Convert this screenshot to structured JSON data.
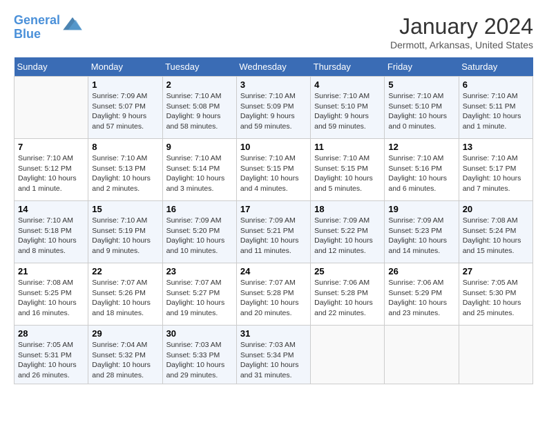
{
  "header": {
    "logo_line1": "General",
    "logo_line2": "Blue",
    "month": "January 2024",
    "location": "Dermott, Arkansas, United States"
  },
  "days_of_week": [
    "Sunday",
    "Monday",
    "Tuesday",
    "Wednesday",
    "Thursday",
    "Friday",
    "Saturday"
  ],
  "weeks": [
    [
      {
        "day": "",
        "sunrise": "",
        "sunset": "",
        "daylight": ""
      },
      {
        "day": "1",
        "sunrise": "Sunrise: 7:09 AM",
        "sunset": "Sunset: 5:07 PM",
        "daylight": "Daylight: 9 hours and 57 minutes."
      },
      {
        "day": "2",
        "sunrise": "Sunrise: 7:10 AM",
        "sunset": "Sunset: 5:08 PM",
        "daylight": "Daylight: 9 hours and 58 minutes."
      },
      {
        "day": "3",
        "sunrise": "Sunrise: 7:10 AM",
        "sunset": "Sunset: 5:09 PM",
        "daylight": "Daylight: 9 hours and 59 minutes."
      },
      {
        "day": "4",
        "sunrise": "Sunrise: 7:10 AM",
        "sunset": "Sunset: 5:10 PM",
        "daylight": "Daylight: 9 hours and 59 minutes."
      },
      {
        "day": "5",
        "sunrise": "Sunrise: 7:10 AM",
        "sunset": "Sunset: 5:10 PM",
        "daylight": "Daylight: 10 hours and 0 minutes."
      },
      {
        "day": "6",
        "sunrise": "Sunrise: 7:10 AM",
        "sunset": "Sunset: 5:11 PM",
        "daylight": "Daylight: 10 hours and 1 minute."
      }
    ],
    [
      {
        "day": "7",
        "sunrise": "Sunrise: 7:10 AM",
        "sunset": "Sunset: 5:12 PM",
        "daylight": "Daylight: 10 hours and 1 minute."
      },
      {
        "day": "8",
        "sunrise": "Sunrise: 7:10 AM",
        "sunset": "Sunset: 5:13 PM",
        "daylight": "Daylight: 10 hours and 2 minutes."
      },
      {
        "day": "9",
        "sunrise": "Sunrise: 7:10 AM",
        "sunset": "Sunset: 5:14 PM",
        "daylight": "Daylight: 10 hours and 3 minutes."
      },
      {
        "day": "10",
        "sunrise": "Sunrise: 7:10 AM",
        "sunset": "Sunset: 5:15 PM",
        "daylight": "Daylight: 10 hours and 4 minutes."
      },
      {
        "day": "11",
        "sunrise": "Sunrise: 7:10 AM",
        "sunset": "Sunset: 5:15 PM",
        "daylight": "Daylight: 10 hours and 5 minutes."
      },
      {
        "day": "12",
        "sunrise": "Sunrise: 7:10 AM",
        "sunset": "Sunset: 5:16 PM",
        "daylight": "Daylight: 10 hours and 6 minutes."
      },
      {
        "day": "13",
        "sunrise": "Sunrise: 7:10 AM",
        "sunset": "Sunset: 5:17 PM",
        "daylight": "Daylight: 10 hours and 7 minutes."
      }
    ],
    [
      {
        "day": "14",
        "sunrise": "Sunrise: 7:10 AM",
        "sunset": "Sunset: 5:18 PM",
        "daylight": "Daylight: 10 hours and 8 minutes."
      },
      {
        "day": "15",
        "sunrise": "Sunrise: 7:10 AM",
        "sunset": "Sunset: 5:19 PM",
        "daylight": "Daylight: 10 hours and 9 minutes."
      },
      {
        "day": "16",
        "sunrise": "Sunrise: 7:09 AM",
        "sunset": "Sunset: 5:20 PM",
        "daylight": "Daylight: 10 hours and 10 minutes."
      },
      {
        "day": "17",
        "sunrise": "Sunrise: 7:09 AM",
        "sunset": "Sunset: 5:21 PM",
        "daylight": "Daylight: 10 hours and 11 minutes."
      },
      {
        "day": "18",
        "sunrise": "Sunrise: 7:09 AM",
        "sunset": "Sunset: 5:22 PM",
        "daylight": "Daylight: 10 hours and 12 minutes."
      },
      {
        "day": "19",
        "sunrise": "Sunrise: 7:09 AM",
        "sunset": "Sunset: 5:23 PM",
        "daylight": "Daylight: 10 hours and 14 minutes."
      },
      {
        "day": "20",
        "sunrise": "Sunrise: 7:08 AM",
        "sunset": "Sunset: 5:24 PM",
        "daylight": "Daylight: 10 hours and 15 minutes."
      }
    ],
    [
      {
        "day": "21",
        "sunrise": "Sunrise: 7:08 AM",
        "sunset": "Sunset: 5:25 PM",
        "daylight": "Daylight: 10 hours and 16 minutes."
      },
      {
        "day": "22",
        "sunrise": "Sunrise: 7:07 AM",
        "sunset": "Sunset: 5:26 PM",
        "daylight": "Daylight: 10 hours and 18 minutes."
      },
      {
        "day": "23",
        "sunrise": "Sunrise: 7:07 AM",
        "sunset": "Sunset: 5:27 PM",
        "daylight": "Daylight: 10 hours and 19 minutes."
      },
      {
        "day": "24",
        "sunrise": "Sunrise: 7:07 AM",
        "sunset": "Sunset: 5:28 PM",
        "daylight": "Daylight: 10 hours and 20 minutes."
      },
      {
        "day": "25",
        "sunrise": "Sunrise: 7:06 AM",
        "sunset": "Sunset: 5:28 PM",
        "daylight": "Daylight: 10 hours and 22 minutes."
      },
      {
        "day": "26",
        "sunrise": "Sunrise: 7:06 AM",
        "sunset": "Sunset: 5:29 PM",
        "daylight": "Daylight: 10 hours and 23 minutes."
      },
      {
        "day": "27",
        "sunrise": "Sunrise: 7:05 AM",
        "sunset": "Sunset: 5:30 PM",
        "daylight": "Daylight: 10 hours and 25 minutes."
      }
    ],
    [
      {
        "day": "28",
        "sunrise": "Sunrise: 7:05 AM",
        "sunset": "Sunset: 5:31 PM",
        "daylight": "Daylight: 10 hours and 26 minutes."
      },
      {
        "day": "29",
        "sunrise": "Sunrise: 7:04 AM",
        "sunset": "Sunset: 5:32 PM",
        "daylight": "Daylight: 10 hours and 28 minutes."
      },
      {
        "day": "30",
        "sunrise": "Sunrise: 7:03 AM",
        "sunset": "Sunset: 5:33 PM",
        "daylight": "Daylight: 10 hours and 29 minutes."
      },
      {
        "day": "31",
        "sunrise": "Sunrise: 7:03 AM",
        "sunset": "Sunset: 5:34 PM",
        "daylight": "Daylight: 10 hours and 31 minutes."
      },
      {
        "day": "",
        "sunrise": "",
        "sunset": "",
        "daylight": ""
      },
      {
        "day": "",
        "sunrise": "",
        "sunset": "",
        "daylight": ""
      },
      {
        "day": "",
        "sunrise": "",
        "sunset": "",
        "daylight": ""
      }
    ]
  ]
}
